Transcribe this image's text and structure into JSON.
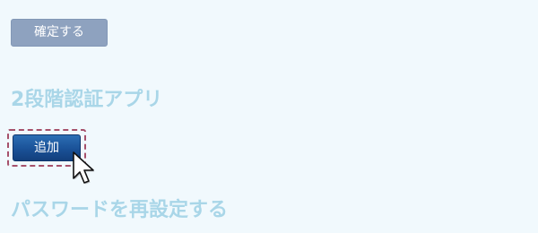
{
  "confirm_button": {
    "label": "確定する"
  },
  "two_factor_app": {
    "heading": "2段階認証アプリ",
    "add_button_label": "追加"
  },
  "reset_password": {
    "heading": "パスワードを再設定する"
  },
  "colors": {
    "background": "#f1f9fd",
    "heading": "#a9d6e8",
    "confirm_button_bg": "#8ea2bf",
    "add_button_bg": "#1a5197",
    "focus_ring": "#a6516b"
  },
  "icons": {
    "cursor": "mouse-pointer-icon"
  }
}
